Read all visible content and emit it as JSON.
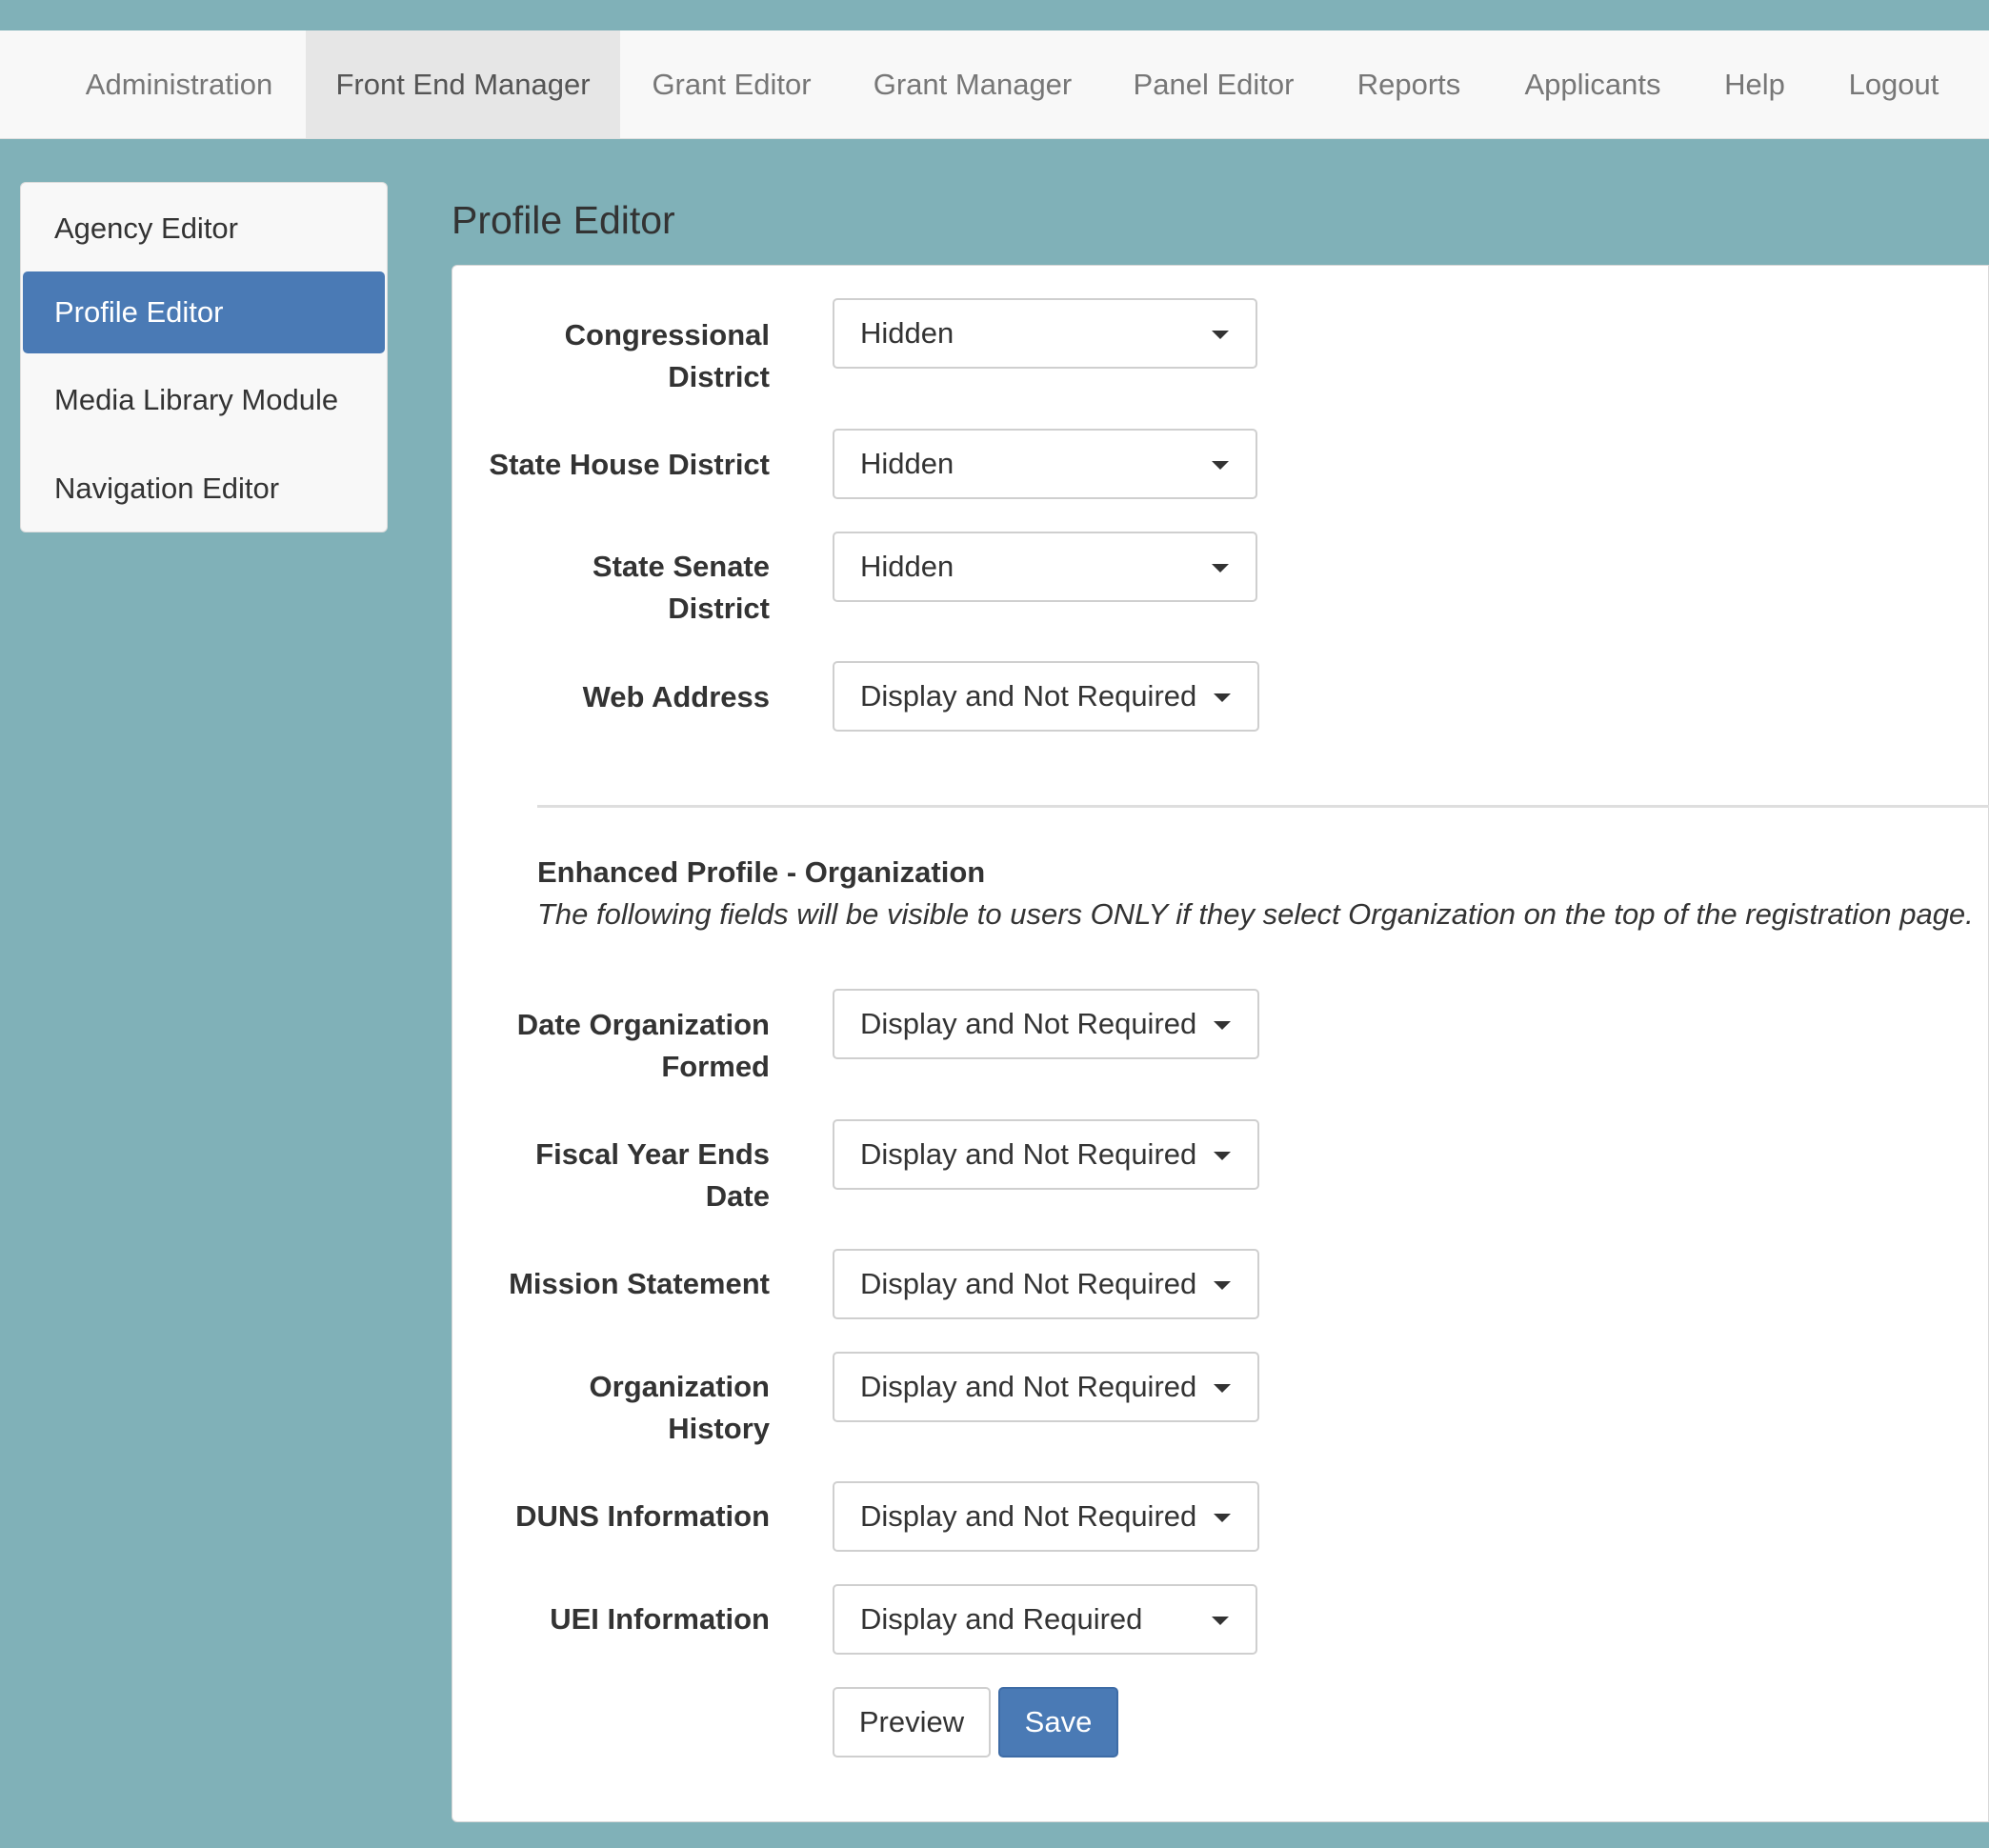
{
  "topnav": {
    "items": [
      {
        "label": "Administration",
        "active": false
      },
      {
        "label": "Front End Manager",
        "active": true
      },
      {
        "label": "Grant Editor",
        "active": false
      },
      {
        "label": "Grant Manager",
        "active": false
      },
      {
        "label": "Panel Editor",
        "active": false
      },
      {
        "label": "Reports",
        "active": false
      },
      {
        "label": "Applicants",
        "active": false
      },
      {
        "label": "Help",
        "active": false
      },
      {
        "label": "Logout",
        "active": false
      }
    ]
  },
  "sidebar": {
    "items": [
      {
        "label": "Agency Editor",
        "active": false
      },
      {
        "label": "Profile Editor",
        "active": true
      },
      {
        "label": "Media Library Module",
        "active": false
      },
      {
        "label": "Navigation Editor",
        "active": false
      }
    ]
  },
  "page": {
    "title": "Profile Editor"
  },
  "fields": [
    {
      "label": "Congressional District",
      "value": "Hidden"
    },
    {
      "label": "State House District",
      "value": "Hidden"
    },
    {
      "label": "State Senate District",
      "value": "Hidden"
    },
    {
      "label": "Web Address",
      "value": "Display and Not Required"
    }
  ],
  "enhanced": {
    "heading": "Enhanced Profile - Organization",
    "note": "The following fields will be visible to users ONLY if they select Organization on the top of the registration page.",
    "fields": [
      {
        "label": "Date Organization Formed",
        "value": "Display and Not Required"
      },
      {
        "label": "Fiscal Year Ends Date",
        "value": "Display and Not Required"
      },
      {
        "label": "Mission Statement",
        "value": "Display and Not Required"
      },
      {
        "label": "Organization History",
        "value": "Display and Not Required"
      },
      {
        "label": "DUNS Information",
        "value": "Display and Not Required"
      },
      {
        "label": "UEI Information",
        "value": "Display and Required"
      }
    ]
  },
  "actions": {
    "preview_label": "Preview",
    "save_label": "Save"
  },
  "colors": {
    "background": "#80b1b8",
    "accent": "#4a7ab5",
    "nav_bg": "#f8f8f8"
  }
}
